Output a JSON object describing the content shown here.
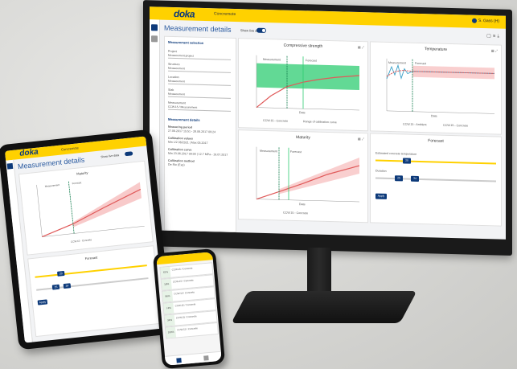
{
  "app": {
    "logo": "doka",
    "app_name": "Concremote",
    "page_title": "Measurement details",
    "live_label": "Show live data",
    "user": "S. Gass (H)",
    "colors": {
      "brand_yellow": "#ffd100",
      "brand_blue": "#0d3a7a",
      "strength_green": "#2ecc71",
      "temp_red": "#e05a5a",
      "accent_red_band": "#f8caca"
    }
  },
  "sidebar": {
    "section_title": "Measurement selection",
    "fields": [
      {
        "label": "Project",
        "value": "Measurement project"
      },
      {
        "label": "Structure",
        "value": "Measurement"
      },
      {
        "label": "Location",
        "value": "Measurement"
      },
      {
        "label": "Slab",
        "value": "Measurement"
      },
      {
        "label": "Measurement",
        "value": "CCW.15 / Measurement"
      }
    ],
    "details_title": "Measurement details",
    "details": [
      {
        "label": "Measuring period",
        "value": "27.06.2017 15:51 - 28.06.2017 09:24"
      },
      {
        "label": "Calibration values",
        "value": "Min 1/2 06/2021 | Max 05.2017"
      },
      {
        "label": "Calibration curve",
        "value": "Min 23.06.2017 09:00 | 12.7 MPa - 19.07.2017"
      },
      {
        "label": "Calibration method",
        "value": "De Rie (Exp)"
      }
    ]
  },
  "charts": {
    "strength": {
      "title": "Compressive strength",
      "legend": [
        "CCW.15 - Concrete",
        "Range of calibration curve"
      ],
      "marker1": "Measurement",
      "marker2": "Forecast",
      "ylabel": "",
      "xlabel": "Date"
    },
    "temperature": {
      "title": "Temperature",
      "legend": [
        "CCW.15 - Ambient",
        "CCW.15 - Concrete"
      ],
      "marker1": "Measurement",
      "marker2": "Forecast",
      "ylabel": "",
      "xlabel": "Date"
    },
    "maturity": {
      "title": "Maturity",
      "legend": [
        "CCW.15 - Concrete"
      ],
      "marker1": "Measurement",
      "marker2": "Forecast",
      "ylabel": "",
      "xlabel": "Date"
    }
  },
  "forecast": {
    "title": "Forecast",
    "temp_label": "Estimated concrete temperature",
    "temp_value": "20",
    "duration_label": "Duration",
    "duration_value": "25",
    "duration_value2": "34",
    "apply_label": "Apply"
  },
  "tablet": {
    "page_title": "Measurement details",
    "chart_title": "Maturity",
    "forecast_title": "Forecast",
    "apply_label": "Apply"
  },
  "phone": {
    "rows": [
      {
        "tag": "62%",
        "title": "CCW.15 / Concrete"
      },
      {
        "tag": "18%",
        "title": "CCW.15 / Concrete"
      },
      {
        "tag": "86%",
        "title": "CCW.15 / Concrete"
      },
      {
        "tag": "74%",
        "title": "CCW.15 / Concrete"
      },
      {
        "tag": "34%",
        "title": "CCW.15 / Concrete"
      },
      {
        "tag": "100%",
        "title": "CCW.15 / Concrete"
      }
    ]
  }
}
